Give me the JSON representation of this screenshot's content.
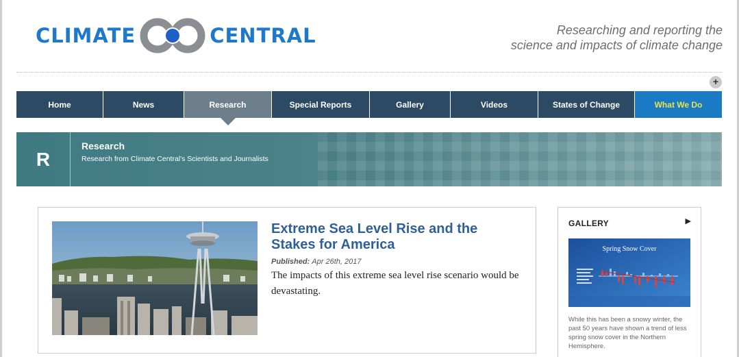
{
  "header": {
    "logo_left": "CLIMATE",
    "logo_right": "CENTRAL",
    "tagline_line1": "Researching and reporting the",
    "tagline_line2": "science and impacts of climate change",
    "expand_label": "+"
  },
  "nav": {
    "items": [
      {
        "label": "Home"
      },
      {
        "label": "News"
      },
      {
        "label": "Research"
      },
      {
        "label": "Special Reports"
      },
      {
        "label": "Gallery"
      },
      {
        "label": "Videos"
      },
      {
        "label": "States of Change"
      },
      {
        "label": "What We Do"
      }
    ],
    "active": "Research"
  },
  "banner": {
    "letter": "R",
    "title": "Research",
    "subtitle": "Research from Climate Central's Scientists and Journalists"
  },
  "article": {
    "title": "Extreme Sea Level Rise and the Stakes for America",
    "published_label": "Published:",
    "published_date": "Apr 26th, 2017",
    "summary": "The impacts of this extreme sea level rise scenario would be devastating."
  },
  "gallery": {
    "heading": "GALLERY",
    "arrow": "▶",
    "image_title": "Spring Snow Cover",
    "caption": "While this has been a snowy winter, the past 50 years have shown a trend of less spring snow cover in the Northern Hemisphere."
  },
  "colors": {
    "brand_blue": "#1f78c8",
    "nav_bg": "#2c4a63",
    "nav_active": "#6d7f8c",
    "nav_accent": "#1a7bc4",
    "accent_text": "#e8e14a",
    "banner_teal": "#4b8289",
    "article_title": "#2e5f98"
  }
}
